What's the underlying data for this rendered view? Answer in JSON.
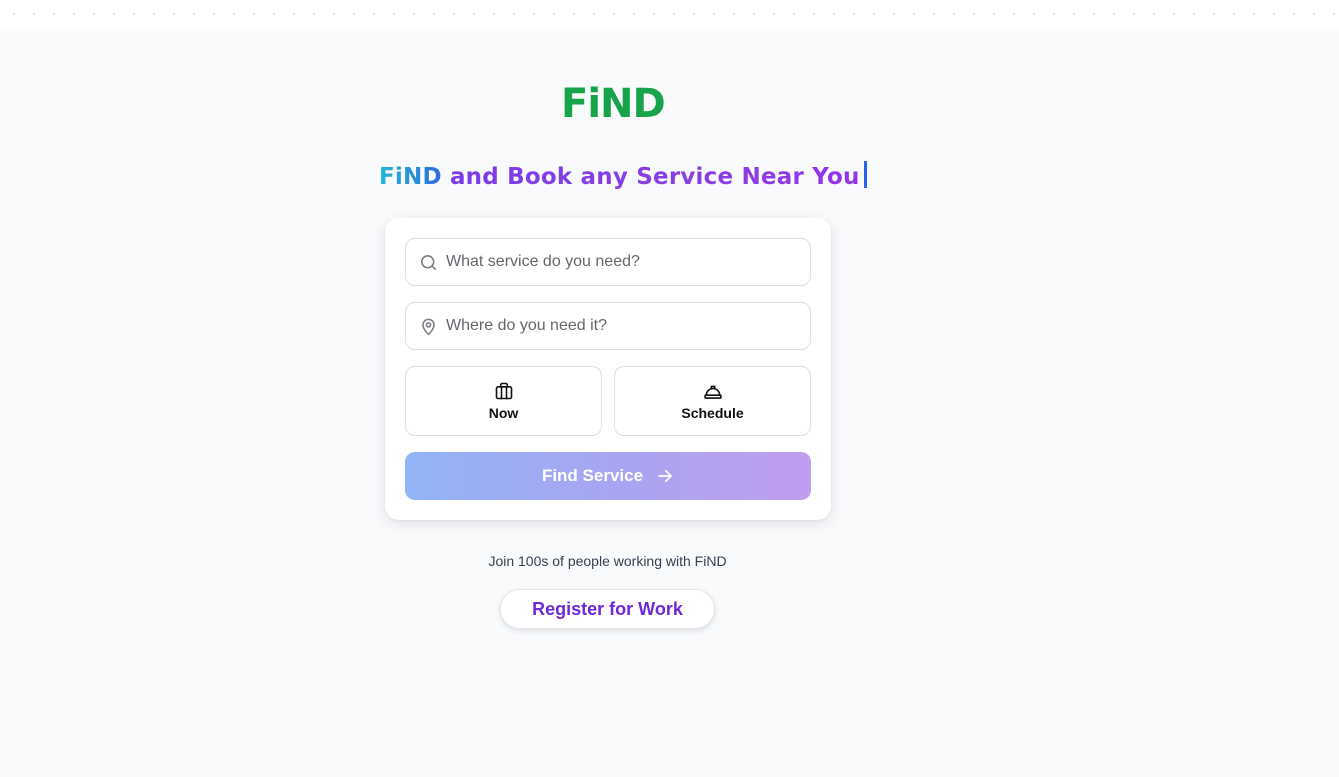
{
  "logo": {
    "text": "FiND",
    "color": "#16a34a"
  },
  "headline": {
    "brand": "FiND",
    "rest": " and Book any Service Near You"
  },
  "search": {
    "service_placeholder": "What service do you need?",
    "location_placeholder": "Where do you need it?",
    "service_icon": "search-icon",
    "location_icon": "map-pin-icon"
  },
  "timing": {
    "now_label": "Now",
    "now_icon": "briefcase-icon",
    "schedule_label": "Schedule",
    "schedule_icon": "hard-hat-icon"
  },
  "cta": {
    "label": "Find Service",
    "icon": "arrow-right-icon"
  },
  "join_text": "Join 100s of people working with FiND",
  "register_label": "Register for Work",
  "colors": {
    "brand_green": "#16a34a",
    "accent_purple": "#7c3aed",
    "accent_blue": "#2563eb",
    "background": "#f8fafc"
  }
}
